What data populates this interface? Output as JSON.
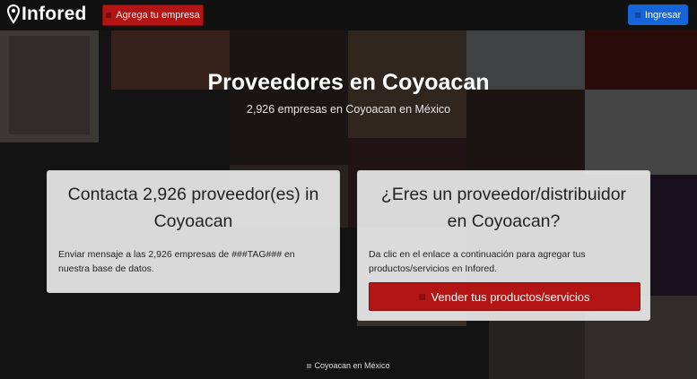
{
  "navbar": {
    "brand": "Infored",
    "add_business_label": "Agrega tu empresa",
    "login_label": "Ingresar"
  },
  "hero": {
    "title": "Proveedores en Coyoacan",
    "subtitle": "2,926 empresas en Coyoacan en México"
  },
  "contact_card": {
    "title": "Contacta 2,926 proveedor(es) in Coyoacan",
    "body": "Enviar mensaje a las 2,926 empresas de ###TAG### en nuestra base de datos."
  },
  "supplier_card": {
    "title": "¿Eres un proveedor/distribuidor en Coyoacan?",
    "body": "Da clic en el enlace a continuación para agregar tus productos/servicios en Infored.",
    "button_label": "Vender tus productos/servicios"
  },
  "footer": {
    "breadcrumb": "Coyoacan en México"
  },
  "colors": {
    "brand_red": "#b31414",
    "login_blue": "#1565d8"
  }
}
